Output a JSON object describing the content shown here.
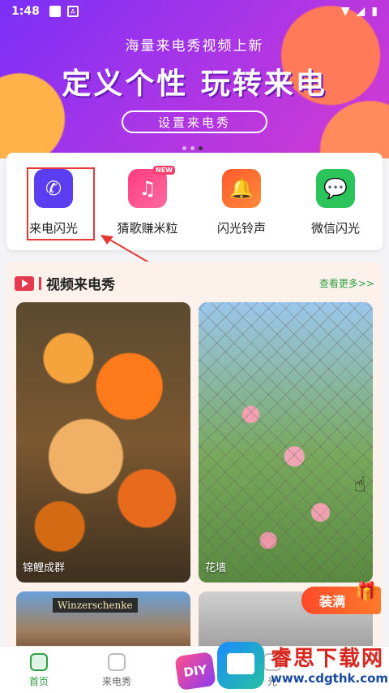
{
  "status": {
    "time": "1:48"
  },
  "banner": {
    "subtitle": "海量来电秀视频上新",
    "title": "定义个性 玩转来电",
    "cta": "设置来电秀"
  },
  "quick_actions": [
    {
      "label": "来电闪光",
      "icon": "phone-flash-icon",
      "color": "#5b3df2"
    },
    {
      "label": "猜歌赚米粒",
      "icon": "music-note-icon",
      "color": "#ff3b7f",
      "badge": "NEW"
    },
    {
      "label": "闪光铃声",
      "icon": "bell-icon",
      "color": "#ff6a2a"
    },
    {
      "label": "微信闪光",
      "icon": "wechat-icon",
      "color": "#2bc45a"
    }
  ],
  "video_section": {
    "title": "视频来电秀",
    "more": "查看更多>>",
    "cards": [
      {
        "caption": "锦鲤成群"
      },
      {
        "caption": "花墙"
      },
      {
        "caption": "",
        "sign": "Winzerschenke"
      },
      {
        "caption": ""
      }
    ],
    "promo": "装满"
  },
  "tabbar": {
    "tabs": [
      {
        "label": "首页"
      },
      {
        "label": "来电秀"
      },
      {
        "label": "DIY"
      },
      {
        "label": "光"
      },
      {
        "label": ""
      }
    ]
  },
  "watermark": {
    "name": "睿思下载网",
    "url": "www.cdgthk.com"
  }
}
